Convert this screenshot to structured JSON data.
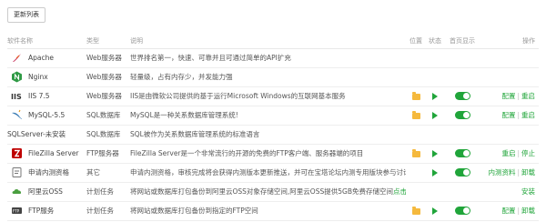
{
  "toolbar": {
    "refresh_label": "更新列表"
  },
  "columns": {
    "name": "软件名称",
    "type": "类型",
    "desc": "说明",
    "location": "位置",
    "state": "状态",
    "homepage": "首页显示",
    "ops": "操作"
  },
  "colors": {
    "accent": "#20a53a",
    "folder": "#f5b93d"
  },
  "rows": [
    {
      "name": "Apache",
      "type": "Web服务器",
      "desc": "世界排名第一，快速、可靠并且可通过简单的API扩充",
      "icon": "apache-feather-icon"
    },
    {
      "name": "Nginx",
      "type": "Web服务器",
      "desc": "轻量级，占有内存少，并发能力强",
      "icon": "nginx-icon"
    },
    {
      "name": "IIS 7.5",
      "type": "Web服务器",
      "desc": "IIS是由微软公司提供的基于运行Microsoft Windows的互联网基本服务",
      "icon": "iis-icon",
      "ops": [
        "配置",
        "重启"
      ]
    },
    {
      "name": "MySQL-5.5",
      "type": "SQL数据库",
      "desc": "MySQL是一种关系数据库管理系统!",
      "icon": "mysql-dolphin-icon",
      "ops": [
        "配置",
        "重启"
      ]
    },
    {
      "name": "SQLServer-未安装",
      "type": "SQL数据库",
      "desc": "SQL被作为关系数据库管理系统的标准语言",
      "icon": "sqlserver-icon"
    },
    {
      "name": "FileZilla Server",
      "type": "FTP服务器",
      "desc": "FileZilla Server是一个非常流行的开源的免费的FTP客户端、服务器端的项目",
      "icon": "filezilla-icon",
      "ops": [
        "重启",
        "停止"
      ]
    },
    {
      "name": "申请内测资格",
      "type": "其它",
      "desc": "申请内测资格，审核完成将会获得内测版本更新推送，并可在宝塔论坛内测专用版块参与讨论",
      "icon": "beta-apply-icon",
      "ops": [
        "内测资料",
        "卸载"
      ]
    },
    {
      "name": "阿里云OSS",
      "type": "计划任务",
      "desc": "将网站或数据库打包备份到阿里云OSS对象存储空间,阿里云OSS提供5GB免费存储空间",
      "desc_link": "点击申请",
      "icon": "aliyun-oss-icon",
      "ops": [
        "安装"
      ]
    },
    {
      "name": "FTP服务",
      "type": "计划任务",
      "desc": "将网站或数据库打包备份到指定的FTP空间",
      "icon": "ftp-service-icon",
      "ops": [
        "配置",
        "卸载"
      ]
    }
  ]
}
